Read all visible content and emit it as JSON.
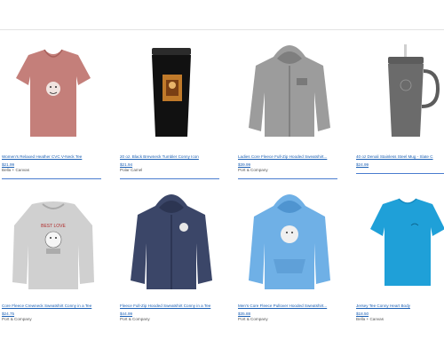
{
  "products": [
    {
      "title": "Women's Relaxed Heather CVC V-Neck Tee",
      "price": "$21.99",
      "brand": "Bella + Canvas",
      "image": "heather-vneck-tee-image"
    },
    {
      "title": "20 oz. Black Brewneck Tumbler Conny Icon",
      "price": "$21.94",
      "brand": "Polar Camel",
      "image": "black-tumbler-image"
    },
    {
      "title": "Ladies Core Fleece Full-Zip Hooded Sweatshirt...",
      "price": "$39.99",
      "brand": "Port & Company",
      "image": "grey-zip-hoodie-image"
    },
    {
      "title": "40 oz Denali Stainless Steel Mug - Slate C",
      "price": "$24.99",
      "brand": "",
      "image": "steel-mug-image"
    },
    {
      "title": "Core Fleece Crewneck Sweatshirt Conny in a Tee",
      "price": "$24.75",
      "brand": "Port & Company",
      "image": "grey-crewneck-image"
    },
    {
      "title": "Fleece Full-Zip Hooded Sweatshirt Conny in a Tee",
      "price": "$44.99",
      "brand": "Port & Company",
      "image": "navy-zip-hoodie-image"
    },
    {
      "title": "Men's Core Fleece Pullover Hooded Sweatshirt...",
      "price": "$35.88",
      "brand": "Port & Company",
      "image": "blue-pullover-hoodie-image"
    },
    {
      "title": "Jersey Tee Conny Heart Body",
      "price": "$18.50",
      "brand": "Bella + Canvas",
      "image": "turquoise-tee-image"
    }
  ],
  "colors": {
    "link": "#1a5fb4",
    "divider": "#4a7ccf",
    "brand_text": "#555555"
  }
}
